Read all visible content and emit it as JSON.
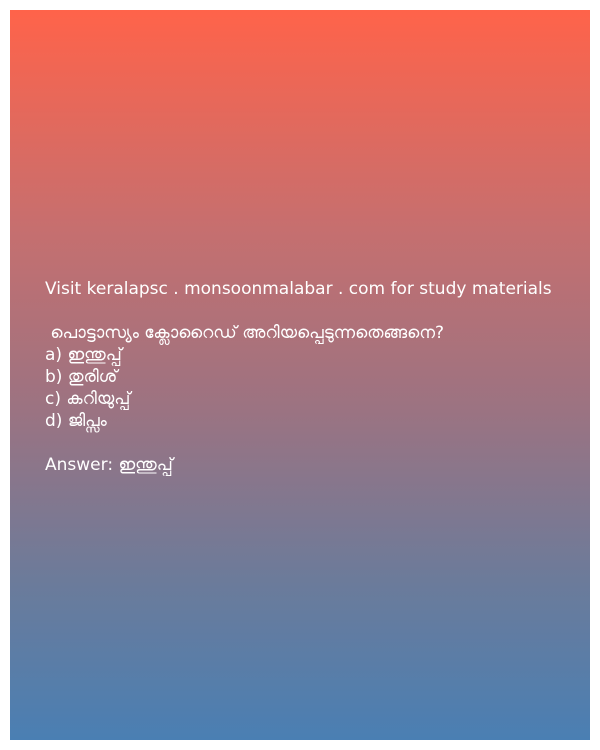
{
  "card": {
    "visit_text": "Visit keralapsc . monsoonmalabar . com for study materials",
    "question": " പൊട്ടാസ്യം ക്ലോറൈഡ് അറിയപ്പെടുന്നതെങ്ങനെ?",
    "options": [
      "a) ഇന്തുപ്പ്",
      "b) തുരിശ്",
      "c) കറിയുപ്പ്",
      "d) ജിപ്സം"
    ],
    "answer": "Answer: ഇന്തുപ്പ്"
  }
}
